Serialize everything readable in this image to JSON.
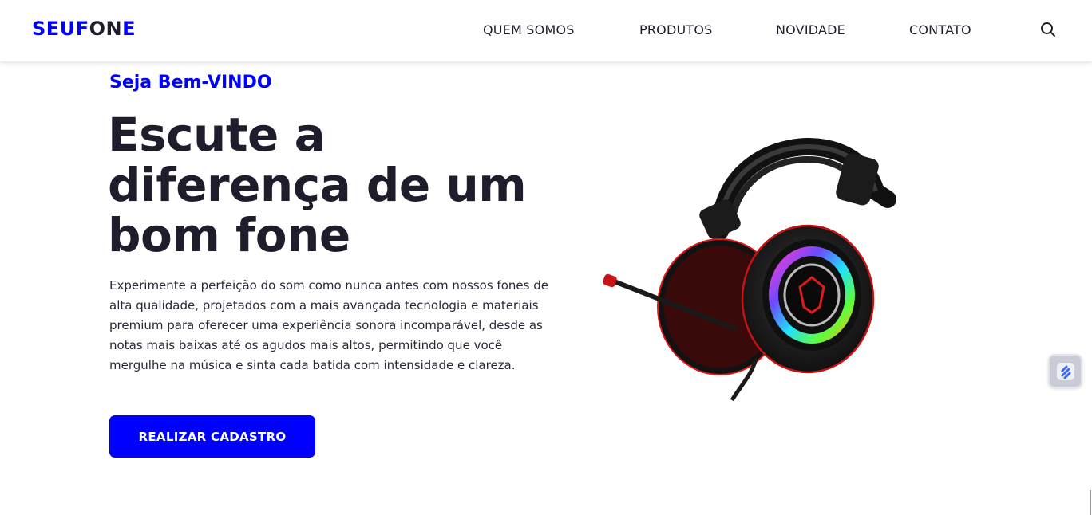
{
  "header": {
    "logo": {
      "part1": "SE",
      "part2": "U",
      "part3": "F",
      "part4": "ON",
      "part5": "E"
    },
    "nav": [
      {
        "label": "QUEM SOMOS"
      },
      {
        "label": "PRODUTOS"
      },
      {
        "label": "NOVIDADE"
      },
      {
        "label": "CONTATO"
      }
    ],
    "search_icon": "search-icon"
  },
  "hero": {
    "welcome": "Seja Bem-VINDO",
    "headline_lines": [
      "Escute a",
      "diferença de um",
      "bom fone"
    ],
    "description_lines": [
      "Experimente a perfeição do som como nunca antes com nossos fones de",
      "alta qualidade, projetados com a mais avançada tecnologia e materiais",
      "premium para oferecer uma experiência sonora incomparável, desde as",
      "notas mais baixas até os agudos mais altos, permitindo que você",
      "mergulhe na música e sinta cada batida com intensidade e clareza."
    ],
    "cta_label": "REALIZAR CADASTRO",
    "product_image": "gaming-headset-image"
  },
  "floating_widget": {
    "icon": "lightning-icon"
  },
  "colors": {
    "brand_blue": "#0000ff",
    "text_dark": "#1f1d2b",
    "background": "#ffffff"
  }
}
